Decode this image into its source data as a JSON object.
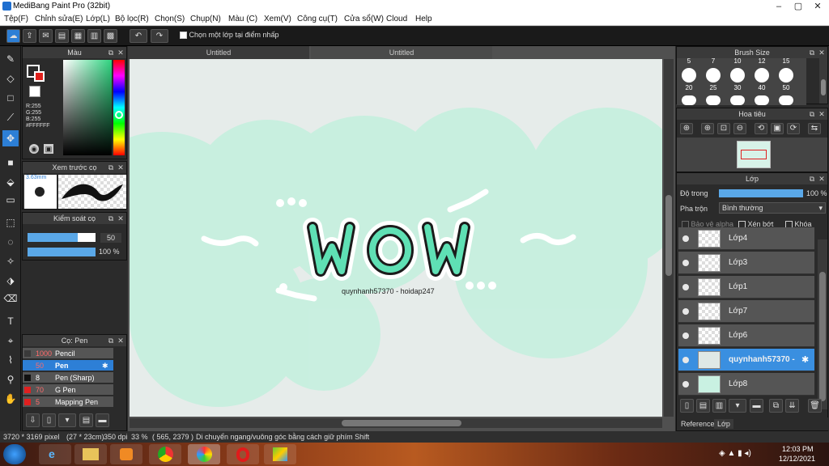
{
  "window": {
    "title": "MediBang Paint Pro (32bit)",
    "minimize": "–",
    "maximize": "▢",
    "close": "✕"
  },
  "menu": [
    "Tệp(F)",
    "Chỉnh sửa(E)",
    "Lớp(L)",
    "Bộ lọc(R)",
    "Chọn(S)",
    "Chụp(N)",
    "Màu (C)",
    "Xem(V)",
    "Công cụ(T)",
    "Cửa sổ(W)",
    "Cloud",
    "Help"
  ],
  "toolbar": {
    "checkbox_label": "Chọn một lớp tại điểm nhấp"
  },
  "color_panel": {
    "title": "Màu",
    "r": "R:255",
    "g": "G:255",
    "b": "B:255",
    "hex": "#FFFFFF",
    "primary": "#e0201c",
    "secondary": "#ffffff"
  },
  "brush_preview": {
    "title": "Xem trước cọ",
    "size": "3.63mm"
  },
  "brush_control": {
    "title": "Kiểm soát cọ",
    "size_value": "50",
    "opacity_value": "100 %"
  },
  "brush_list": {
    "title": "Cọ: Pen",
    "items": [
      {
        "size": "1000",
        "name": "Pencil",
        "color": "#3a3a3a"
      },
      {
        "size": "50",
        "name": "Pen",
        "color": "#2d7fd6"
      },
      {
        "size": "8",
        "name": "Pen (Sharp)",
        "color": "#111111"
      },
      {
        "size": "70",
        "name": "G Pen",
        "color": "#e02020"
      },
      {
        "size": "5",
        "name": "Mapping Pen",
        "color": "#e02020"
      }
    ]
  },
  "tabs": [
    "Untitled",
    "Untitled"
  ],
  "artwork": {
    "main_text": "wow",
    "credit": "quynhanh57370 - hoidap247"
  },
  "brush_size_panel": {
    "title": "Brush Size",
    "top_labels": [
      "5",
      "7",
      "10",
      "12",
      "15"
    ],
    "labels": [
      "20",
      "25",
      "30",
      "40",
      "50"
    ]
  },
  "navigator": {
    "title": "Hoa tiêu"
  },
  "layer_panel": {
    "title": "Lớp",
    "opacity_label": "Độ trong",
    "opacity_value": "100 %",
    "opacity_fraction": 1.0,
    "blend_label": "Pha trộn",
    "blend_value": "Bình thường",
    "protect_alpha": "Bảo vệ alpha",
    "clipping": "Xén bớt",
    "lock": "Khóa",
    "layers": [
      "Lớp4",
      "Lớp3",
      "Lớp1",
      "Lớp7",
      "Lớp6",
      "quynhanh57370 - ",
      "Lớp8"
    ],
    "bottom_tabs": [
      "Reference",
      "Lớp"
    ]
  },
  "status": {
    "dimensions": "3720 * 3169 pixel",
    "cm": "(27 * 23cm)",
    "dpi": "350 dpi",
    "zoom": "33 %",
    "coords": "( 565, 2379 )",
    "hint": "Di chuyển ngang/vuông góc bằng cách giữ phím Shift"
  },
  "taskbar": {
    "time": "12:03 PM",
    "date": "12/12/2021"
  }
}
